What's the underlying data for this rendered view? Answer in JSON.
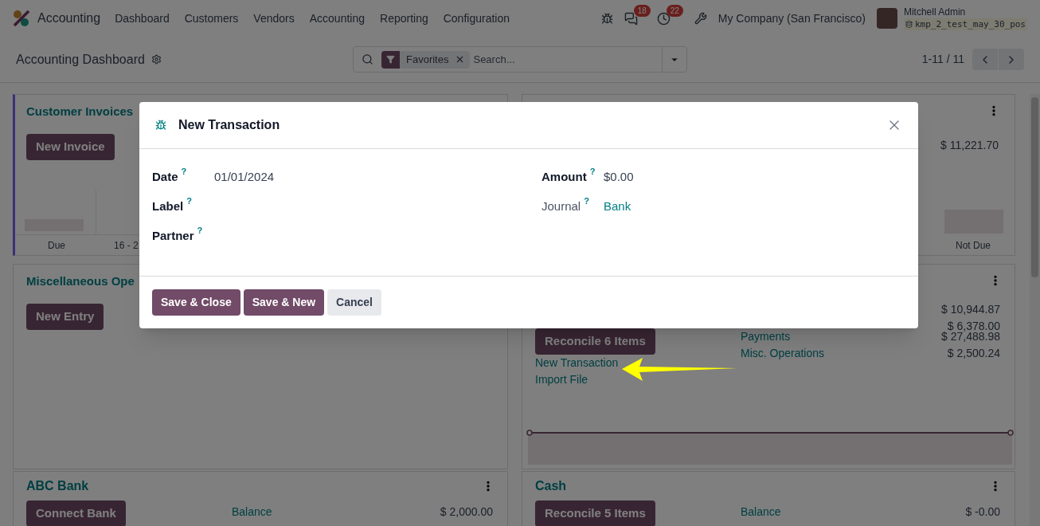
{
  "navbar": {
    "app_name": "Accounting",
    "menu": [
      "Dashboard",
      "Customers",
      "Vendors",
      "Accounting",
      "Reporting",
      "Configuration"
    ],
    "messages_badge": "18",
    "activities_badge": "22",
    "company": "My Company (San Francisco)",
    "user_name": "Mitchell Admin",
    "database": "kmp_2_test_may_30_pos"
  },
  "control_panel": {
    "title": "Accounting Dashboard",
    "search": {
      "facet": "Favorites",
      "placeholder": "Search..."
    },
    "pager": "1-11 / 11"
  },
  "dashboard": {
    "customer_invoices": {
      "title": "Customer Invoices",
      "button": "New Invoice",
      "chart_labels": [
        "Due",
        "16 - 2"
      ]
    },
    "sales": {
      "amount": "$ 11,221.70",
      "chart_label": "Not Due"
    },
    "misc": {
      "title": "Miscellaneous Ope",
      "button": "New Entry"
    },
    "bank": {
      "amounts": [
        "$ 10,944.87",
        "$ 6,378.00"
      ],
      "button": "Reconcile 6 Items",
      "links": [
        "New Transaction",
        "Import File"
      ],
      "rows": [
        {
          "label": "Payments",
          "amount": "$ 27,488.98"
        },
        {
          "label": "Misc. Operations",
          "amount": "$ 2,500.24"
        }
      ]
    },
    "abc_bank": {
      "title": "ABC Bank",
      "button": "Connect Bank",
      "row": {
        "label": "Balance",
        "amount": "$ 2,000.00"
      }
    },
    "cash": {
      "title": "Cash",
      "button": "Reconcile 5 Items",
      "row": {
        "label": "Balance",
        "amount": "$ -0.00"
      }
    }
  },
  "dialog": {
    "title": "New Transaction",
    "left_fields": [
      {
        "label": "Date",
        "help": "?",
        "value": "01/01/2024",
        "required": true,
        "link": false
      },
      {
        "label": "Label",
        "help": "?",
        "required": true
      },
      {
        "label": "Partner",
        "help": "?",
        "required": true
      }
    ],
    "right_fields": [
      {
        "label": "Amount",
        "help": "?",
        "value": "$0.00",
        "required": true,
        "link": false
      },
      {
        "label": "Journal",
        "help": "?",
        "value": "Bank",
        "required": false,
        "link": true
      }
    ],
    "buttons": [
      {
        "label": "Save & Close",
        "kind": "primary"
      },
      {
        "label": "Save & New",
        "kind": "primary"
      },
      {
        "label": "Cancel",
        "kind": "secondary"
      }
    ]
  }
}
